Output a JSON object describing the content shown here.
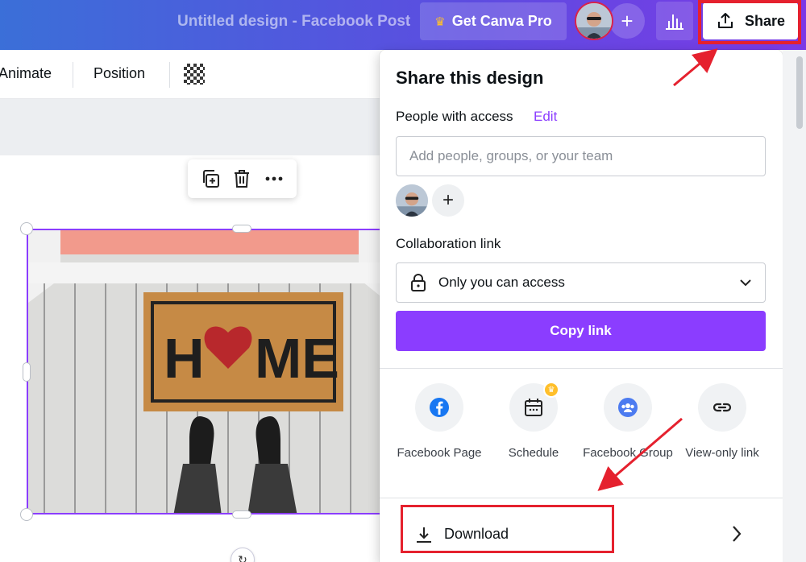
{
  "topbar": {
    "doc_title": "Untitled design - Facebook Post",
    "pro_label": "Get Canva Pro",
    "share_label": "Share"
  },
  "toolbar": {
    "animate_label": "Animate",
    "position_label": "Position"
  },
  "share_panel": {
    "title": "Share this design",
    "people_access_label": "People with access",
    "edit_label": "Edit",
    "people_placeholder": "Add people, groups, or your team",
    "collab_link_label": "Collaboration link",
    "access_value": "Only you can access",
    "copy_link_label": "Copy link",
    "options": [
      {
        "label": "Facebook Page",
        "icon": "facebook-icon"
      },
      {
        "label": "Schedule",
        "icon": "calendar-icon",
        "pro": true
      },
      {
        "label": "Facebook Group",
        "icon": "group-icon"
      },
      {
        "label": "View-only link",
        "icon": "link-icon"
      }
    ],
    "download_label": "Download"
  },
  "canvas": {
    "image_text": "H♥ME"
  },
  "colors": {
    "accent": "#8b3dff",
    "highlight": "#e5212e",
    "facebook": "#1877f2"
  }
}
